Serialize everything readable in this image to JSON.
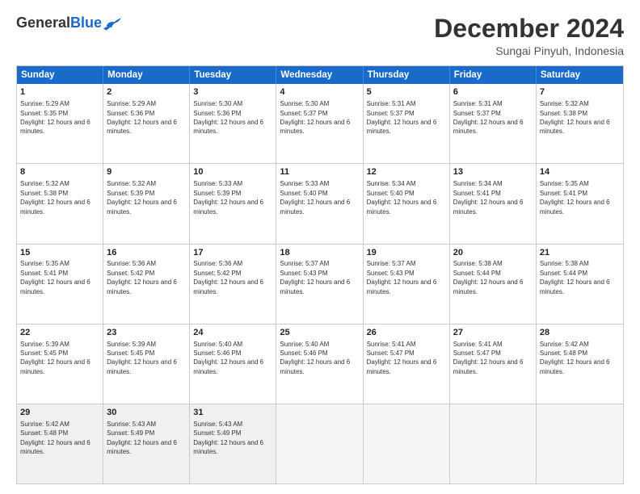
{
  "logo": {
    "general": "General",
    "blue": "Blue"
  },
  "title": {
    "month": "December 2024",
    "location": "Sungai Pinyuh, Indonesia"
  },
  "days": [
    "Sunday",
    "Monday",
    "Tuesday",
    "Wednesday",
    "Thursday",
    "Friday",
    "Saturday"
  ],
  "weeks": [
    [
      {
        "day": "1",
        "rise": "5:29 AM",
        "set": "5:35 PM",
        "daylight": "12 hours and 6 minutes."
      },
      {
        "day": "2",
        "rise": "5:29 AM",
        "set": "5:36 PM",
        "daylight": "12 hours and 6 minutes."
      },
      {
        "day": "3",
        "rise": "5:30 AM",
        "set": "5:36 PM",
        "daylight": "12 hours and 6 minutes."
      },
      {
        "day": "4",
        "rise": "5:30 AM",
        "set": "5:37 PM",
        "daylight": "12 hours and 6 minutes."
      },
      {
        "day": "5",
        "rise": "5:31 AM",
        "set": "5:37 PM",
        "daylight": "12 hours and 6 minutes."
      },
      {
        "day": "6",
        "rise": "5:31 AM",
        "set": "5:37 PM",
        "daylight": "12 hours and 6 minutes."
      },
      {
        "day": "7",
        "rise": "5:32 AM",
        "set": "5:38 PM",
        "daylight": "12 hours and 6 minutes."
      }
    ],
    [
      {
        "day": "8",
        "rise": "5:32 AM",
        "set": "5:38 PM",
        "daylight": "12 hours and 6 minutes."
      },
      {
        "day": "9",
        "rise": "5:32 AM",
        "set": "5:39 PM",
        "daylight": "12 hours and 6 minutes."
      },
      {
        "day": "10",
        "rise": "5:33 AM",
        "set": "5:39 PM",
        "daylight": "12 hours and 6 minutes."
      },
      {
        "day": "11",
        "rise": "5:33 AM",
        "set": "5:40 PM",
        "daylight": "12 hours and 6 minutes."
      },
      {
        "day": "12",
        "rise": "5:34 AM",
        "set": "5:40 PM",
        "daylight": "12 hours and 6 minutes."
      },
      {
        "day": "13",
        "rise": "5:34 AM",
        "set": "5:41 PM",
        "daylight": "12 hours and 6 minutes."
      },
      {
        "day": "14",
        "rise": "5:35 AM",
        "set": "5:41 PM",
        "daylight": "12 hours and 6 minutes."
      }
    ],
    [
      {
        "day": "15",
        "rise": "5:35 AM",
        "set": "5:41 PM",
        "daylight": "12 hours and 6 minutes."
      },
      {
        "day": "16",
        "rise": "5:36 AM",
        "set": "5:42 PM",
        "daylight": "12 hours and 6 minutes."
      },
      {
        "day": "17",
        "rise": "5:36 AM",
        "set": "5:42 PM",
        "daylight": "12 hours and 6 minutes."
      },
      {
        "day": "18",
        "rise": "5:37 AM",
        "set": "5:43 PM",
        "daylight": "12 hours and 6 minutes."
      },
      {
        "day": "19",
        "rise": "5:37 AM",
        "set": "5:43 PM",
        "daylight": "12 hours and 6 minutes."
      },
      {
        "day": "20",
        "rise": "5:38 AM",
        "set": "5:44 PM",
        "daylight": "12 hours and 6 minutes."
      },
      {
        "day": "21",
        "rise": "5:38 AM",
        "set": "5:44 PM",
        "daylight": "12 hours and 6 minutes."
      }
    ],
    [
      {
        "day": "22",
        "rise": "5:39 AM",
        "set": "5:45 PM",
        "daylight": "12 hours and 6 minutes."
      },
      {
        "day": "23",
        "rise": "5:39 AM",
        "set": "5:45 PM",
        "daylight": "12 hours and 6 minutes."
      },
      {
        "day": "24",
        "rise": "5:40 AM",
        "set": "5:46 PM",
        "daylight": "12 hours and 6 minutes."
      },
      {
        "day": "25",
        "rise": "5:40 AM",
        "set": "5:46 PM",
        "daylight": "12 hours and 6 minutes."
      },
      {
        "day": "26",
        "rise": "5:41 AM",
        "set": "5:47 PM",
        "daylight": "12 hours and 6 minutes."
      },
      {
        "day": "27",
        "rise": "5:41 AM",
        "set": "5:47 PM",
        "daylight": "12 hours and 6 minutes."
      },
      {
        "day": "28",
        "rise": "5:42 AM",
        "set": "5:48 PM",
        "daylight": "12 hours and 6 minutes."
      }
    ],
    [
      {
        "day": "29",
        "rise": "5:42 AM",
        "set": "5:48 PM",
        "daylight": "12 hours and 6 minutes."
      },
      {
        "day": "30",
        "rise": "5:43 AM",
        "set": "5:49 PM",
        "daylight": "12 hours and 6 minutes."
      },
      {
        "day": "31",
        "rise": "5:43 AM",
        "set": "5:49 PM",
        "daylight": "12 hours and 6 minutes."
      },
      null,
      null,
      null,
      null
    ]
  ]
}
